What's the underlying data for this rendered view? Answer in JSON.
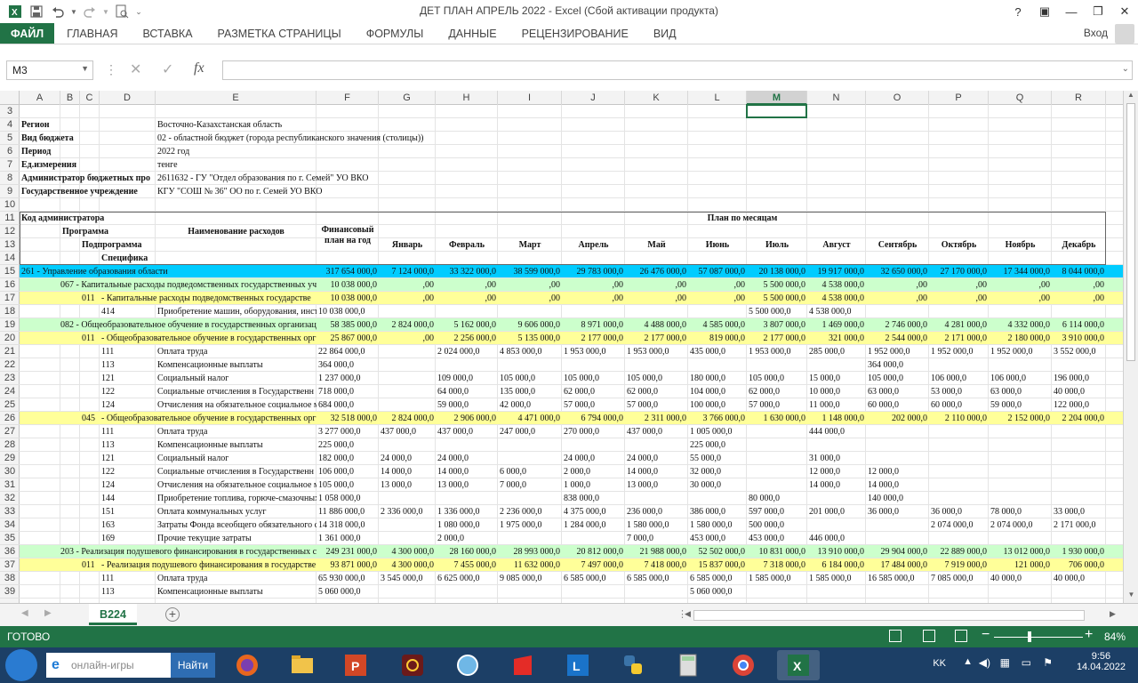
{
  "window": {
    "title": "ДЕТ ПЛАН АПРЕЛЬ 2022 - Excel (Сбой активации продукта)",
    "help": "?",
    "ribbon_display": "▣",
    "min": "—",
    "max": "❐",
    "close": "✕"
  },
  "ribbon": {
    "tabs": [
      "ФАЙЛ",
      "ГЛАВНАЯ",
      "ВСТАВКА",
      "РАЗМЕТКА СТРАНИЦЫ",
      "ФОРМУЛЫ",
      "ДАННЫЕ",
      "РЕЦЕНЗИРОВАНИЕ",
      "ВИД"
    ],
    "login": "Вход"
  },
  "formula_bar": {
    "name_box": "M3",
    "fx": "fx",
    "value": ""
  },
  "columns": [
    "A",
    "B",
    "C",
    "D",
    "E",
    "F",
    "G",
    "H",
    "I",
    "J",
    "K",
    "L",
    "M",
    "N",
    "O",
    "P",
    "Q",
    "R"
  ],
  "selected_column": "M",
  "selected_cell": "M3",
  "rows": [
    "3",
    "4",
    "5",
    "6",
    "7",
    "8",
    "9",
    "10",
    "11",
    "12",
    "13",
    "14",
    "15",
    "16",
    "17",
    "18",
    "19",
    "20",
    "21",
    "22",
    "23",
    "24",
    "25",
    "26",
    "27",
    "28",
    "29",
    "30",
    "31",
    "32",
    "33",
    "34",
    "35",
    "36",
    "37",
    "38",
    "39"
  ],
  "header_info": {
    "region_label": "Регион",
    "region": "Восточно-Казахстанская область",
    "budget_label": "Вид бюджета",
    "budget": "02 - областной бюджет (города республиканского значения (столицы))",
    "period_label": "Период",
    "period": "2022 год",
    "unit_label": "Ед.измерения",
    "unit": "тенге",
    "admin_label": "Администратор бюджетных про",
    "admin": "2611632 - ГУ \"Отдел образования по г. Семей\"  УО ВКО",
    "inst_label": "Государственное учреждение",
    "inst": "КГУ \"СОШ № 36\" ОО по г. Семей УО ВКО"
  },
  "table_header": {
    "code_admin": "Код администратора",
    "program": "Программа",
    "subprogram": "Подпрограмма",
    "specific": "Специфика",
    "name": "Наименование расходов",
    "fin_plan": "Финансовый план на год",
    "months_title": "План по месяцам",
    "months": [
      "Январь",
      "Февраль",
      "Март",
      "Апрель",
      "Май",
      "Июнь",
      "Июль",
      "Август",
      "Сентябрь",
      "Октябрь",
      "Ноябрь",
      "Декабрь"
    ]
  },
  "data_rows": [
    {
      "row": "15",
      "style": "cyan",
      "prog": "",
      "sub": "",
      "spec": "",
      "name": "261 - Управление образования области",
      "total": "317 654 000,0",
      "m": [
        "7 124 000,0",
        "33 322 000,0",
        "38 599 000,0",
        "29 783 000,0",
        "26 476 000,0",
        "57 087 000,0",
        "20 138 000,0",
        "19 917 000,0",
        "32 650 000,0",
        "27 170 000,0",
        "17 344 000,0",
        "8 044 000,0"
      ]
    },
    {
      "row": "16",
      "style": "green",
      "prog": "067",
      "sub": "",
      "spec": "",
      "name": "067 - Капитальные расходы подведомственных государственных уч",
      "total": "10 038 000,0",
      "m": [
        ",00",
        ",00",
        ",00",
        ",00",
        ",00",
        ",00",
        "5 500 000,0",
        "4 538 000,0",
        ",00",
        ",00",
        ",00",
        ",00"
      ]
    },
    {
      "row": "17",
      "style": "yellow",
      "prog": "",
      "sub": "011",
      "spec": "",
      "name": "- Капитальные расходы подведомственных государстве",
      "total": "10 038 000,0",
      "m": [
        ",00",
        ",00",
        ",00",
        ",00",
        ",00",
        ",00",
        "5 500 000,0",
        "4 538 000,0",
        ",00",
        ",00",
        ",00",
        ",00"
      ]
    },
    {
      "row": "18",
      "style": "",
      "prog": "",
      "sub": "",
      "spec": "414",
      "name": "Приобретение машин, оборудования, инст",
      "total": "10 038 000,0",
      "m": [
        "",
        "",
        "",
        "",
        "",
        "",
        "5 500 000,0",
        "4 538 000,0",
        "",
        "",
        "",
        ""
      ]
    },
    {
      "row": "19",
      "style": "green",
      "prog": "082",
      "sub": "",
      "spec": "",
      "name": "082 - Общеобразовательное обучение в государственных организац",
      "total": "58 385 000,0",
      "m": [
        "2 824 000,0",
        "5 162 000,0",
        "9 606 000,0",
        "8 971 000,0",
        "4 488 000,0",
        "4 585 000,0",
        "3 807 000,0",
        "1 469 000,0",
        "2 746 000,0",
        "4 281 000,0",
        "4 332 000,0",
        "6 114 000,0"
      ]
    },
    {
      "row": "20",
      "style": "yellow",
      "prog": "",
      "sub": "011",
      "spec": "",
      "name": "- Общеобразовательное обучение в государственных орг",
      "total": "25 867 000,0",
      "m": [
        ",00",
        "2 256 000,0",
        "5 135 000,0",
        "2 177 000,0",
        "2 177 000,0",
        "819 000,0",
        "2 177 000,0",
        "321 000,0",
        "2 544 000,0",
        "2 171 000,0",
        "2 180 000,0",
        "3 910 000,0"
      ]
    },
    {
      "row": "21",
      "style": "",
      "prog": "",
      "sub": "",
      "spec": "111",
      "name": "Оплата труда",
      "total": "22 864 000,0",
      "m": [
        "",
        "2 024 000,0",
        "4 853 000,0",
        "1 953 000,0",
        "1 953 000,0",
        "435 000,0",
        "1 953 000,0",
        "285 000,0",
        "1 952 000,0",
        "1 952 000,0",
        "1 952 000,0",
        "3 552 000,0"
      ]
    },
    {
      "row": "22",
      "style": "",
      "prog": "",
      "sub": "",
      "spec": "113",
      "name": "Компенсационные выплаты",
      "total": "364 000,0",
      "m": [
        "",
        "",
        "",
        "",
        "",
        "",
        "",
        "",
        "364 000,0",
        "",
        "",
        ""
      ]
    },
    {
      "row": "23",
      "style": "",
      "prog": "",
      "sub": "",
      "spec": "121",
      "name": "Социальный налог",
      "total": "1 237 000,0",
      "m": [
        "",
        "109 000,0",
        "105 000,0",
        "105 000,0",
        "105 000,0",
        "180 000,0",
        "105 000,0",
        "15 000,0",
        "105 000,0",
        "106 000,0",
        "106 000,0",
        "196 000,0"
      ]
    },
    {
      "row": "24",
      "style": "",
      "prog": "",
      "sub": "",
      "spec": "122",
      "name": "Социальные отчисления в Государственн",
      "total": "718 000,0",
      "m": [
        "",
        "64 000,0",
        "135 000,0",
        "62 000,0",
        "62 000,0",
        "104 000,0",
        "62 000,0",
        "10 000,0",
        "63 000,0",
        "53 000,0",
        "63 000,0",
        "40 000,0"
      ]
    },
    {
      "row": "25",
      "style": "",
      "prog": "",
      "sub": "",
      "spec": "124",
      "name": "Отчисления на обязательное социальное м",
      "total": "684 000,0",
      "m": [
        "",
        "59 000,0",
        "42 000,0",
        "57 000,0",
        "57 000,0",
        "100 000,0",
        "57 000,0",
        "11 000,0",
        "60 000,0",
        "60 000,0",
        "59 000,0",
        "122 000,0"
      ]
    },
    {
      "row": "26",
      "style": "yellow",
      "prog": "",
      "sub": "045",
      "spec": "",
      "name": "- Общеобразовательное обучение в государственных орг",
      "total": "32 518 000,0",
      "m": [
        "2 824 000,0",
        "2 906 000,0",
        "4 471 000,0",
        "6 794 000,0",
        "2 311 000,0",
        "3 766 000,0",
        "1 630 000,0",
        "1 148 000,0",
        "202 000,0",
        "2 110 000,0",
        "2 152 000,0",
        "2 204 000,0"
      ]
    },
    {
      "row": "27",
      "style": "",
      "prog": "",
      "sub": "",
      "spec": "111",
      "name": "Оплата труда",
      "total": "3 277 000,0",
      "m": [
        "437 000,0",
        "437 000,0",
        "247 000,0",
        "270 000,0",
        "437 000,0",
        "1 005 000,0",
        "",
        "444 000,0",
        "",
        "",
        "",
        ""
      ]
    },
    {
      "row": "28",
      "style": "",
      "prog": "",
      "sub": "",
      "spec": "113",
      "name": "Компенсационные выплаты",
      "total": "225 000,0",
      "m": [
        "",
        "",
        "",
        "",
        "",
        "225 000,0",
        "",
        "",
        "",
        "",
        "",
        ""
      ]
    },
    {
      "row": "29",
      "style": "",
      "prog": "",
      "sub": "",
      "spec": "121",
      "name": "Социальный налог",
      "total": "182 000,0",
      "m": [
        "24 000,0",
        "24 000,0",
        "",
        "24 000,0",
        "24 000,0",
        "55 000,0",
        "",
        "31 000,0",
        "",
        "",
        "",
        ""
      ]
    },
    {
      "row": "30",
      "style": "",
      "prog": "",
      "sub": "",
      "spec": "122",
      "name": "Социальные отчисления в Государственн",
      "total": "106 000,0",
      "m": [
        "14 000,0",
        "14 000,0",
        "6 000,0",
        "2 000,0",
        "14 000,0",
        "32 000,0",
        "",
        "12 000,0",
        "12 000,0",
        "",
        "",
        ""
      ]
    },
    {
      "row": "31",
      "style": "",
      "prog": "",
      "sub": "",
      "spec": "124",
      "name": "Отчисления на обязательное социальное м",
      "total": "105 000,0",
      "m": [
        "13 000,0",
        "13 000,0",
        "7 000,0",
        "1 000,0",
        "13 000,0",
        "30 000,0",
        "",
        "14 000,0",
        "14 000,0",
        "",
        "",
        ""
      ]
    },
    {
      "row": "32",
      "style": "",
      "prog": "",
      "sub": "",
      "spec": "144",
      "name": "Приобретение топлива, горюче-смазочных",
      "total": "1 058 000,0",
      "m": [
        "",
        "",
        "",
        "838 000,0",
        "",
        "",
        "80 000,0",
        "",
        "140 000,0",
        "",
        "",
        ""
      ]
    },
    {
      "row": "33",
      "style": "",
      "prog": "",
      "sub": "",
      "spec": "151",
      "name": "Оплата коммунальных услуг",
      "total": "11 886 000,0",
      "m": [
        "2 336 000,0",
        "1 336 000,0",
        "2 236 000,0",
        "4 375 000,0",
        "236 000,0",
        "386 000,0",
        "597 000,0",
        "201 000,0",
        "36 000,0",
        "36 000,0",
        "78 000,0",
        "33 000,0"
      ]
    },
    {
      "row": "34",
      "style": "",
      "prog": "",
      "sub": "",
      "spec": "163",
      "name": "Затраты Фонда всеобщего обязательного с",
      "total": "14 318 000,0",
      "m": [
        "",
        "1 080 000,0",
        "1 975 000,0",
        "1 284 000,0",
        "1 580 000,0",
        "1 580 000,0",
        "500 000,0",
        "",
        "",
        "2 074 000,0",
        "2 074 000,0",
        "2 171 000,0"
      ]
    },
    {
      "row": "35",
      "style": "",
      "prog": "",
      "sub": "",
      "spec": "169",
      "name": "Прочие текущие затраты",
      "total": "1 361 000,0",
      "m": [
        "",
        "2 000,0",
        "",
        "",
        "7 000,0",
        "453 000,0",
        "453 000,0",
        "446 000,0",
        "",
        "",
        "",
        ""
      ]
    },
    {
      "row": "36",
      "style": "green",
      "prog": "203",
      "sub": "",
      "spec": "",
      "name": "203 - Реализация подушевого финансирования в государственных с",
      "total": "249 231 000,0",
      "m": [
        "4 300 000,0",
        "28 160 000,0",
        "28 993 000,0",
        "20 812 000,0",
        "21 988 000,0",
        "52 502 000,0",
        "10 831 000,0",
        "13 910 000,0",
        "29 904 000,0",
        "22 889 000,0",
        "13 012 000,0",
        "1 930 000,0"
      ]
    },
    {
      "row": "37",
      "style": "yellow",
      "prog": "",
      "sub": "011",
      "spec": "",
      "name": "- Реализация подушевого финансирования в государстве",
      "total": "93 871 000,0",
      "m": [
        "4 300 000,0",
        "7 455 000,0",
        "11 632 000,0",
        "7 497 000,0",
        "7 418 000,0",
        "15 837 000,0",
        "7 318 000,0",
        "6 184 000,0",
        "17 484 000,0",
        "7 919 000,0",
        "121 000,0",
        "706 000,0"
      ]
    },
    {
      "row": "38",
      "style": "",
      "prog": "",
      "sub": "",
      "spec": "111",
      "name": "Оплата труда",
      "total": "65 930 000,0",
      "m": [
        "3 545 000,0",
        "6 625 000,0",
        "9 085 000,0",
        "6 585 000,0",
        "6 585 000,0",
        "6 585 000,0",
        "1 585 000,0",
        "1 585 000,0",
        "16 585 000,0",
        "7 085 000,0",
        "40 000,0",
        "40 000,0"
      ]
    },
    {
      "row": "39",
      "style": "",
      "prog": "",
      "sub": "",
      "spec": "113",
      "name": "Компенсационные выплаты",
      "total": "5 060 000,0",
      "m": [
        "",
        "",
        "",
        "",
        "",
        "5 060 000,0",
        "",
        "",
        "",
        "",
        "",
        ""
      ]
    }
  ],
  "sheet_tab": "В224",
  "status": {
    "text": "ГОТОВО",
    "zoom": "84%"
  },
  "taskbar": {
    "search_placeholder": "онлайн-игры",
    "search_button": "Найти",
    "lang": "KK",
    "time": "9:56",
    "date": "14.04.2022"
  },
  "colors": {
    "cyan": "#00ccff",
    "green": "#ccffcc",
    "yellow": "#ffff99",
    "accent": "#217346"
  }
}
